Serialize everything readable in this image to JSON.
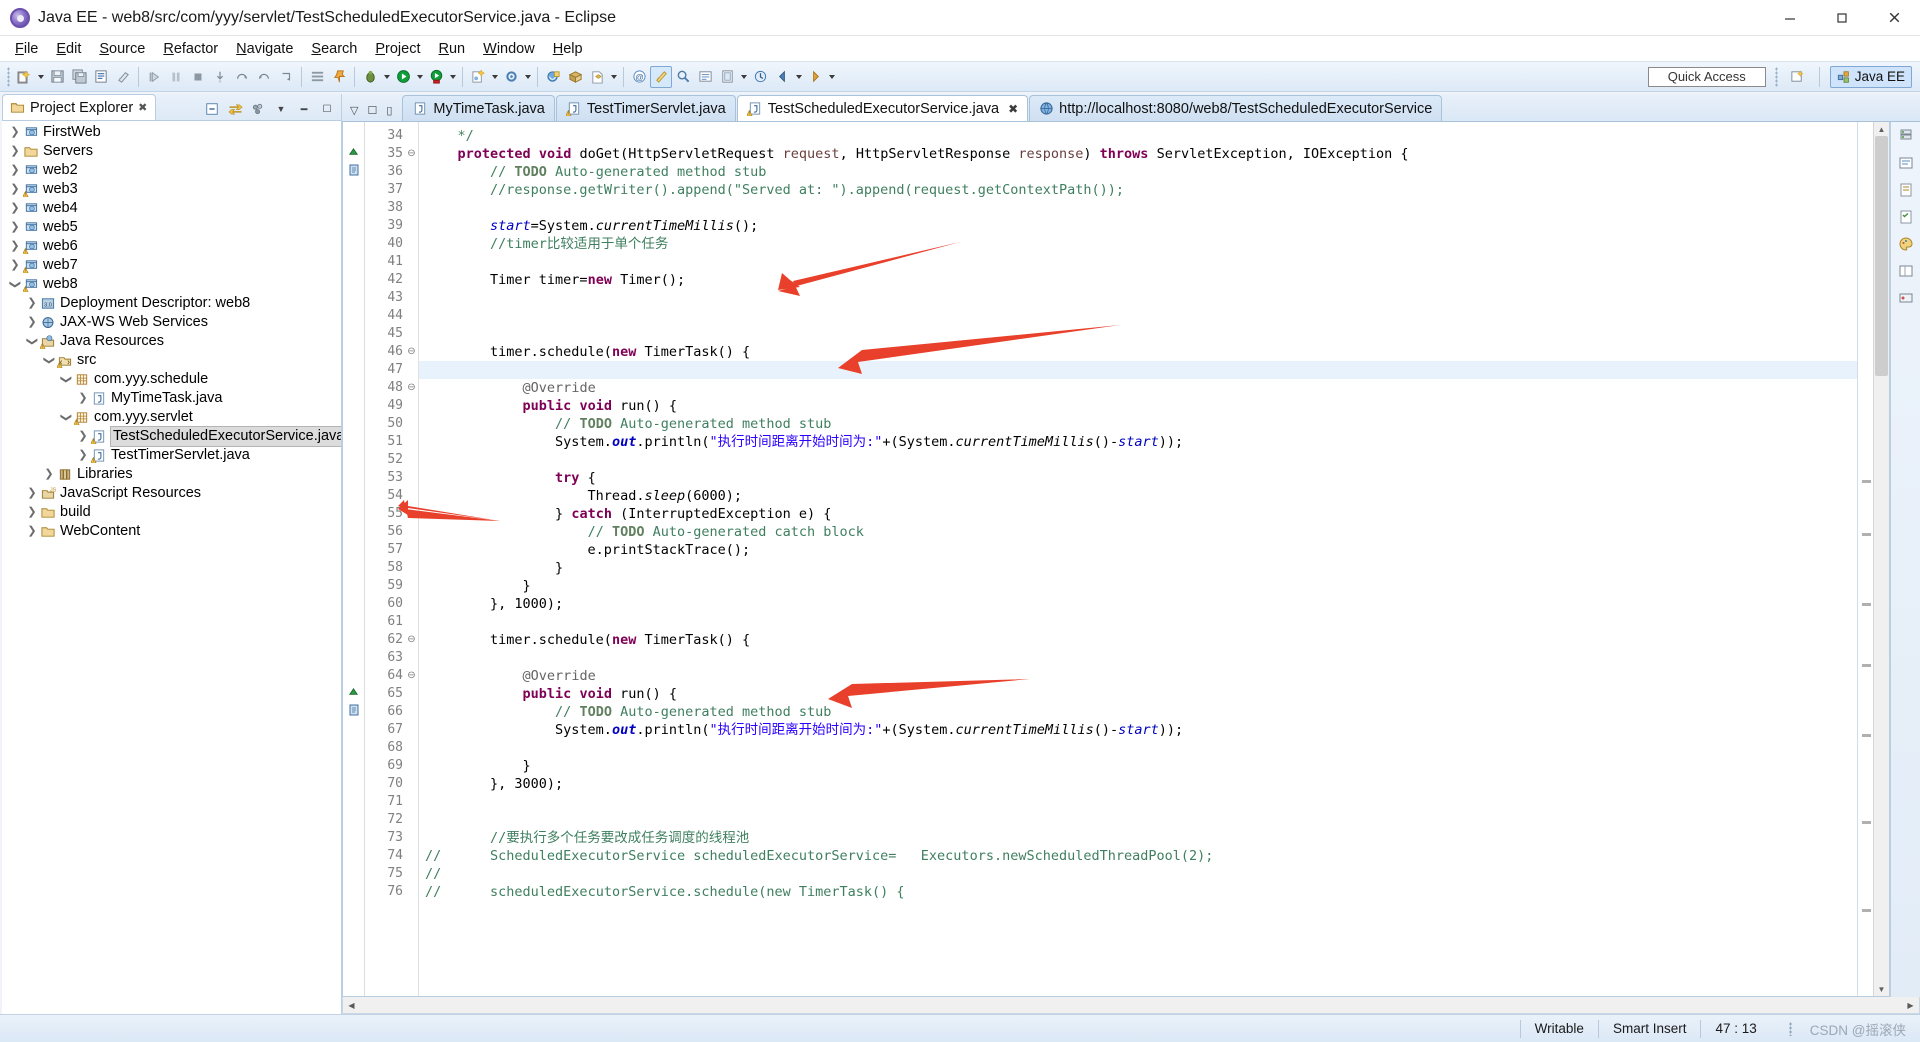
{
  "window": {
    "title": "Java EE - web8/src/com/yyy/servlet/TestScheduledExecutorService.java - Eclipse",
    "minimize": "–",
    "maximize": "❐",
    "close": "✕"
  },
  "menu": [
    {
      "label": "File"
    },
    {
      "label": "Edit"
    },
    {
      "label": "Source"
    },
    {
      "label": "Refactor"
    },
    {
      "label": "Navigate"
    },
    {
      "label": "Search"
    },
    {
      "label": "Project"
    },
    {
      "label": "Run"
    },
    {
      "label": "Window"
    },
    {
      "label": "Help"
    }
  ],
  "toolbar": {
    "quick_access_label": "Quick Access",
    "perspective_label": "Java EE",
    "icons": [
      "new-wizard-icon",
      "save-icon",
      "save-all-icon",
      "print-icon",
      "toggle-markoccurrences-icon",
      "resume-icon",
      "suspend-icon",
      "terminate-icon",
      "step-into-icon",
      "step-over-icon",
      "step-return-icon",
      "drop-to-frame-icon",
      "open-task-icon",
      "pin-icon",
      "debug-icon",
      "run-icon",
      "run-server-icon",
      "coverage-icon",
      "external-tools-icon",
      "new-java-project-icon",
      "new-package-icon",
      "new-class-icon",
      "new-annotation-icon",
      "java-browsing-icon",
      "search-icon",
      "open-type-icon",
      "open-resource-icon",
      "last-edit-location-icon",
      "back-icon",
      "forward-icon"
    ]
  },
  "project_explorer": {
    "tab_label": "Project Explorer",
    "tab_close": "✖",
    "tools": [
      "collapse-all-icon",
      "link-with-editor-icon",
      "view-menu-icon",
      "minimize-icon",
      "maximize-icon"
    ],
    "tree": [
      {
        "label": "FirstWeb",
        "depth": 0,
        "state": "collapsed",
        "icon": "web-project-icon",
        "warn": false
      },
      {
        "label": "Servers",
        "depth": 0,
        "state": "collapsed",
        "icon": "folder-icon",
        "warn": false
      },
      {
        "label": "web2",
        "depth": 0,
        "state": "collapsed",
        "icon": "web-project-icon",
        "warn": false
      },
      {
        "label": "web3",
        "depth": 0,
        "state": "collapsed",
        "icon": "web-project-icon",
        "warn": true
      },
      {
        "label": "web4",
        "depth": 0,
        "state": "collapsed",
        "icon": "web-project-icon",
        "warn": false
      },
      {
        "label": "web5",
        "depth": 0,
        "state": "collapsed",
        "icon": "web-project-icon",
        "warn": false
      },
      {
        "label": "web6",
        "depth": 0,
        "state": "collapsed",
        "icon": "web-project-icon",
        "warn": true
      },
      {
        "label": "web7",
        "depth": 0,
        "state": "collapsed",
        "icon": "web-project-icon",
        "warn": true
      },
      {
        "label": "web8",
        "depth": 0,
        "state": "expanded",
        "icon": "web-project-icon",
        "warn": true
      },
      {
        "label": "Deployment Descriptor: web8",
        "depth": 1,
        "state": "collapsed",
        "icon": "deployment-descriptor-icon",
        "warn": false
      },
      {
        "label": "JAX-WS Web Services",
        "depth": 1,
        "state": "collapsed",
        "icon": "jaxws-icon",
        "warn": false
      },
      {
        "label": "Java Resources",
        "depth": 1,
        "state": "expanded",
        "icon": "java-resources-icon",
        "warn": true
      },
      {
        "label": "src",
        "depth": 2,
        "state": "expanded",
        "icon": "source-folder-icon",
        "warn": true
      },
      {
        "label": "com.yyy.schedule",
        "depth": 3,
        "state": "expanded",
        "icon": "package-icon",
        "warn": false
      },
      {
        "label": "MyTimeTask.java",
        "depth": 4,
        "state": "collapsed",
        "icon": "java-file-icon",
        "warn": false
      },
      {
        "label": "com.yyy.servlet",
        "depth": 3,
        "state": "expanded",
        "icon": "package-icon",
        "warn": true
      },
      {
        "label": "TestScheduledExecutorService.java",
        "depth": 4,
        "state": "collapsed",
        "icon": "java-file-icon",
        "warn": true,
        "selected": true
      },
      {
        "label": "TestTimerServlet.java",
        "depth": 4,
        "state": "collapsed",
        "icon": "java-file-icon",
        "warn": true
      },
      {
        "label": "Libraries",
        "depth": 2,
        "state": "collapsed",
        "icon": "libraries-icon",
        "warn": false
      },
      {
        "label": "JavaScript Resources",
        "depth": 1,
        "state": "collapsed",
        "icon": "js-resources-icon",
        "warn": false
      },
      {
        "label": "build",
        "depth": 1,
        "state": "collapsed",
        "icon": "folder-icon",
        "warn": false
      },
      {
        "label": "WebContent",
        "depth": 1,
        "state": "collapsed",
        "icon": "folder-icon",
        "warn": false
      }
    ]
  },
  "editor": {
    "tabs": [
      {
        "label": "MyTimeTask.java",
        "icon": "java-file-icon",
        "active": false,
        "warn": false,
        "closable": false
      },
      {
        "label": "TestTimerServlet.java",
        "icon": "java-file-icon",
        "active": false,
        "warn": true,
        "closable": false
      },
      {
        "label": "TestScheduledExecutorService.java",
        "icon": "java-file-icon",
        "active": true,
        "warn": true,
        "closable": true,
        "close": "✖"
      },
      {
        "label": "http://localhost:8080/web8/TestScheduledExecutorService",
        "icon": "browser-icon",
        "active": false,
        "warn": false,
        "closable": false
      }
    ],
    "first_line_number": 34,
    "highlight_line": 47,
    "lines": [
      {
        "n": 34,
        "fold": "",
        "marker": "",
        "html": "    <span class='cm'>*/</span>"
      },
      {
        "n": 35,
        "fold": "⊖",
        "marker": "up-arrow",
        "html": "    <span class='k'>protected</span> <span class='k'>void</span> doGet(HttpServletRequest <span class='par'>request</span>, HttpServletResponse <span class='par'>response</span>) <span class='k'>throws</span> ServletException, IOException {"
      },
      {
        "n": 36,
        "fold": "",
        "marker": "task",
        "html": "        <span class='cm'>// <span class='td'>TODO</span> Auto-generated method stub</span>"
      },
      {
        "n": 37,
        "fold": "",
        "marker": "",
        "html": "        <span class='cm'>//response.getWriter().append(\"Served at: \").append(request.getContextPath());</span>"
      },
      {
        "n": 38,
        "fold": "",
        "marker": "",
        "html": ""
      },
      {
        "n": 39,
        "fold": "",
        "marker": "",
        "html": "        <span class='fld'>start</span>=System.<span class='mth'>currentTimeMillis</span>();"
      },
      {
        "n": 40,
        "fold": "",
        "marker": "",
        "html": "        <span class='cm'>//timer比较适用于单个任务</span>"
      },
      {
        "n": 41,
        "fold": "",
        "marker": "",
        "html": ""
      },
      {
        "n": 42,
        "fold": "",
        "marker": "",
        "html": "        Timer timer=<span class='k'>new</span> Timer();"
      },
      {
        "n": 43,
        "fold": "",
        "marker": "",
        "html": ""
      },
      {
        "n": 44,
        "fold": "",
        "marker": "",
        "html": ""
      },
      {
        "n": 45,
        "fold": "",
        "marker": "",
        "html": ""
      },
      {
        "n": 46,
        "fold": "⊖",
        "marker": "",
        "html": "        timer.schedule(<span class='k'>new</span> TimerTask() {"
      },
      {
        "n": 47,
        "fold": "",
        "marker": "",
        "html": ""
      },
      {
        "n": 48,
        "fold": "⊖",
        "marker": "",
        "html": "            <span class='an'>@Override</span>"
      },
      {
        "n": 49,
        "fold": "",
        "marker": "",
        "html": "            <span class='k'>public</span> <span class='k'>void</span> run() {"
      },
      {
        "n": 50,
        "fold": "",
        "marker": "",
        "html": "                <span class='cm'>// <span class='td'>TODO</span> Auto-generated method stub</span>"
      },
      {
        "n": 51,
        "fold": "",
        "marker": "",
        "html": "                System.<span class='sf'>out</span>.println(<span class='st'>\"执行时间距离开始时间为:\"</span>+(System.<span class='mth'>currentTimeMillis</span>()-<span class='fld'>start</span>));"
      },
      {
        "n": 52,
        "fold": "",
        "marker": "",
        "html": ""
      },
      {
        "n": 53,
        "fold": "",
        "marker": "",
        "html": "                <span class='k'>try</span> {"
      },
      {
        "n": 54,
        "fold": "",
        "marker": "",
        "html": "                    Thread.<span class='mth'>sleep</span>(6000);"
      },
      {
        "n": 55,
        "fold": "",
        "marker": "",
        "html": "                } <span class='k'>catch</span> (InterruptedException e) {"
      },
      {
        "n": 56,
        "fold": "",
        "marker": "",
        "html": "                    <span class='cm'>// <span class='td'>TODO</span> Auto-generated catch block</span>"
      },
      {
        "n": 57,
        "fold": "",
        "marker": "",
        "html": "                    e.printStackTrace();"
      },
      {
        "n": 58,
        "fold": "",
        "marker": "",
        "html": "                }"
      },
      {
        "n": 59,
        "fold": "",
        "marker": "",
        "html": "            }"
      },
      {
        "n": 60,
        "fold": "",
        "marker": "",
        "html": "        }, 1000);"
      },
      {
        "n": 61,
        "fold": "",
        "marker": "",
        "html": ""
      },
      {
        "n": 62,
        "fold": "⊖",
        "marker": "",
        "html": "        timer.schedule(<span class='k'>new</span> TimerTask() {"
      },
      {
        "n": 63,
        "fold": "",
        "marker": "",
        "html": ""
      },
      {
        "n": 64,
        "fold": "⊖",
        "marker": "",
        "html": "            <span class='an'>@Override</span>"
      },
      {
        "n": 65,
        "fold": "",
        "marker": "up-arrow",
        "html": "            <span class='k'>public</span> <span class='k'>void</span> run() {"
      },
      {
        "n": 66,
        "fold": "",
        "marker": "task",
        "html": "                <span class='cm'>// <span class='td'>TODO</span> Auto-generated method stub</span>"
      },
      {
        "n": 67,
        "fold": "",
        "marker": "",
        "html": "                System.<span class='sf'>out</span>.println(<span class='st'>\"执行时间距离开始时间为:\"</span>+(System.<span class='mth'>currentTimeMillis</span>()-<span class='fld'>start</span>));"
      },
      {
        "n": 68,
        "fold": "",
        "marker": "",
        "html": ""
      },
      {
        "n": 69,
        "fold": "",
        "marker": "",
        "html": "            }"
      },
      {
        "n": 70,
        "fold": "",
        "marker": "",
        "html": "        }, 3000);"
      },
      {
        "n": 71,
        "fold": "",
        "marker": "",
        "html": ""
      },
      {
        "n": 72,
        "fold": "",
        "marker": "",
        "html": ""
      },
      {
        "n": 73,
        "fold": "",
        "marker": "",
        "html": "        <span class='cm'>//要执行多个任务要改成任务调度的线程池</span>"
      },
      {
        "n": 74,
        "fold": "",
        "marker": "",
        "prefix": "//",
        "html": "        <span class='cm'>ScheduledExecutorService scheduledExecutorService=   Executors.newScheduledThreadPool(2);</span>"
      },
      {
        "n": 75,
        "fold": "",
        "marker": "",
        "prefix": "//",
        "html": ""
      },
      {
        "n": 76,
        "fold": "",
        "marker": "",
        "prefix": "//",
        "html": "        <span class='cm'>scheduledExecutorService.schedule(new TimerTask() {</span>"
      }
    ]
  },
  "statusbar": {
    "writable": "Writable",
    "insert_mode": "Smart Insert",
    "cursor_position": "47 : 13",
    "watermark": "CSDN @摇滚侠"
  },
  "annotations": {
    "arrow_count": 4,
    "arrow_color": "#e8402a",
    "targets": [
      "line-42-timer-new",
      "line-46-timer-schedule",
      "tree-TestScheduledExecutorService.java",
      "line-62-timer-schedule"
    ]
  }
}
